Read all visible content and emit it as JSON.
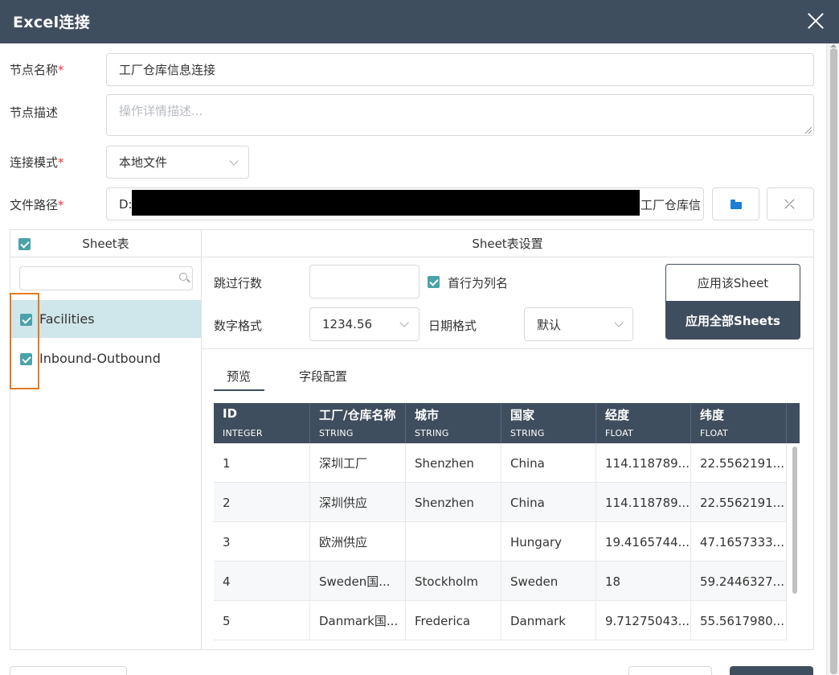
{
  "dialog": {
    "title": "Excel连接"
  },
  "form": {
    "node_name_label": "节点名称",
    "node_name_value": "工厂仓库信息连接",
    "node_desc_label": "节点描述",
    "node_desc_placeholder": "操作详情描述...",
    "conn_mode_label": "连接模式",
    "conn_mode_value": "本地文件",
    "file_path_label": "文件路径",
    "file_path_prefix": "D:",
    "file_path_suffix": "工厂仓库信",
    "required_mark": "*"
  },
  "sheets": {
    "header": "Sheet表",
    "items": [
      {
        "label": "Facilities",
        "checked": true,
        "active": true
      },
      {
        "label": "Inbound-Outbound",
        "checked": true,
        "active": false
      }
    ]
  },
  "settings": {
    "header": "Sheet表设置",
    "skip_rows_label": "跳过行数",
    "first_row_header_label": "首行为列名",
    "number_format_label": "数字格式",
    "number_format_value": "1234.56",
    "date_format_label": "日期格式",
    "date_format_value": "默认",
    "apply_sheet_label": "应用该Sheet",
    "apply_all_label": "应用全部Sheets"
  },
  "tabs": [
    {
      "label": "预览",
      "active": true
    },
    {
      "label": "字段配置",
      "active": false
    }
  ],
  "table": {
    "columns": [
      {
        "name": "ID",
        "type": "INTEGER"
      },
      {
        "name": "工厂/仓库名称",
        "type": "STRING"
      },
      {
        "name": "城市",
        "type": "STRING"
      },
      {
        "name": "国家",
        "type": "STRING"
      },
      {
        "name": "经度",
        "type": "FLOAT"
      },
      {
        "name": "纬度",
        "type": "FLOAT"
      }
    ],
    "rows": [
      [
        "1",
        "深圳工厂",
        "Shenzhen",
        "China",
        "114.118789...",
        "22.5562191..."
      ],
      [
        "2",
        "深圳供应",
        "Shenzhen",
        "China",
        "114.118789...",
        "22.5562191..."
      ],
      [
        "3",
        "欧洲供应",
        "",
        "Hungary",
        "19.4165744...",
        "47.1657333..."
      ],
      [
        "4",
        "Sweden国...",
        "Stockholm",
        "Sweden",
        "18",
        "59.2446327..."
      ],
      [
        "5",
        "Danmark国...",
        "Frederica",
        "Danmark",
        "9.71275043...",
        "55.5617980..."
      ]
    ]
  },
  "colors": {
    "header_bg": "#3f4e5e",
    "checkbox": "#4aa3a8",
    "active_sheet_bg": "#cfe6ea",
    "highlight_border": "#e27a26",
    "required": "#e4393c"
  }
}
